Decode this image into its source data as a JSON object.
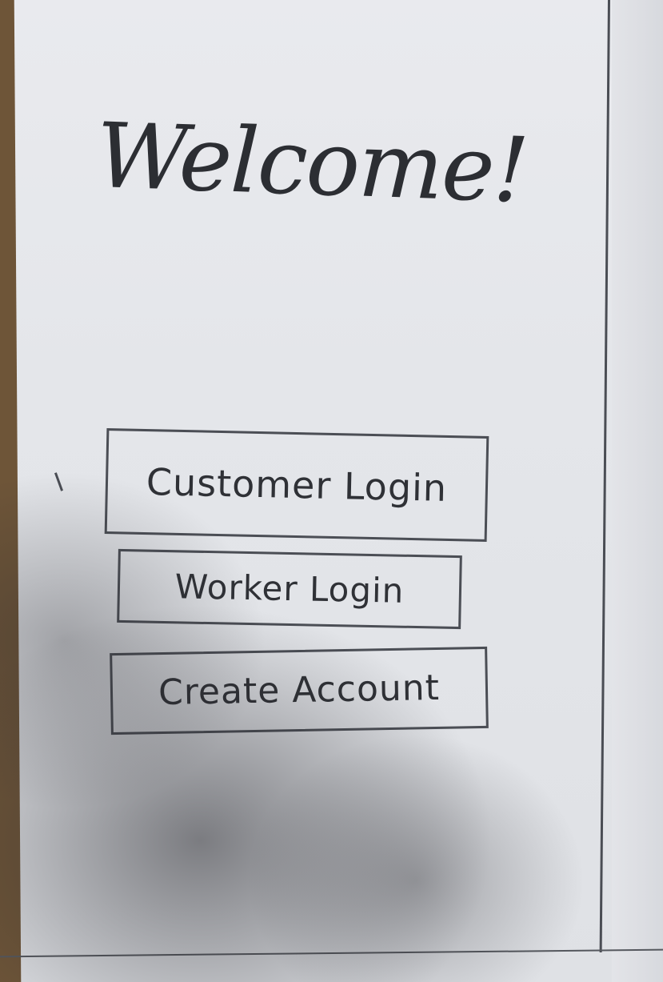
{
  "screen": {
    "title": "Welcome!"
  },
  "actions": {
    "customer_login": "Customer Login",
    "worker_login": "Worker Login",
    "create_account": "Create Account"
  }
}
